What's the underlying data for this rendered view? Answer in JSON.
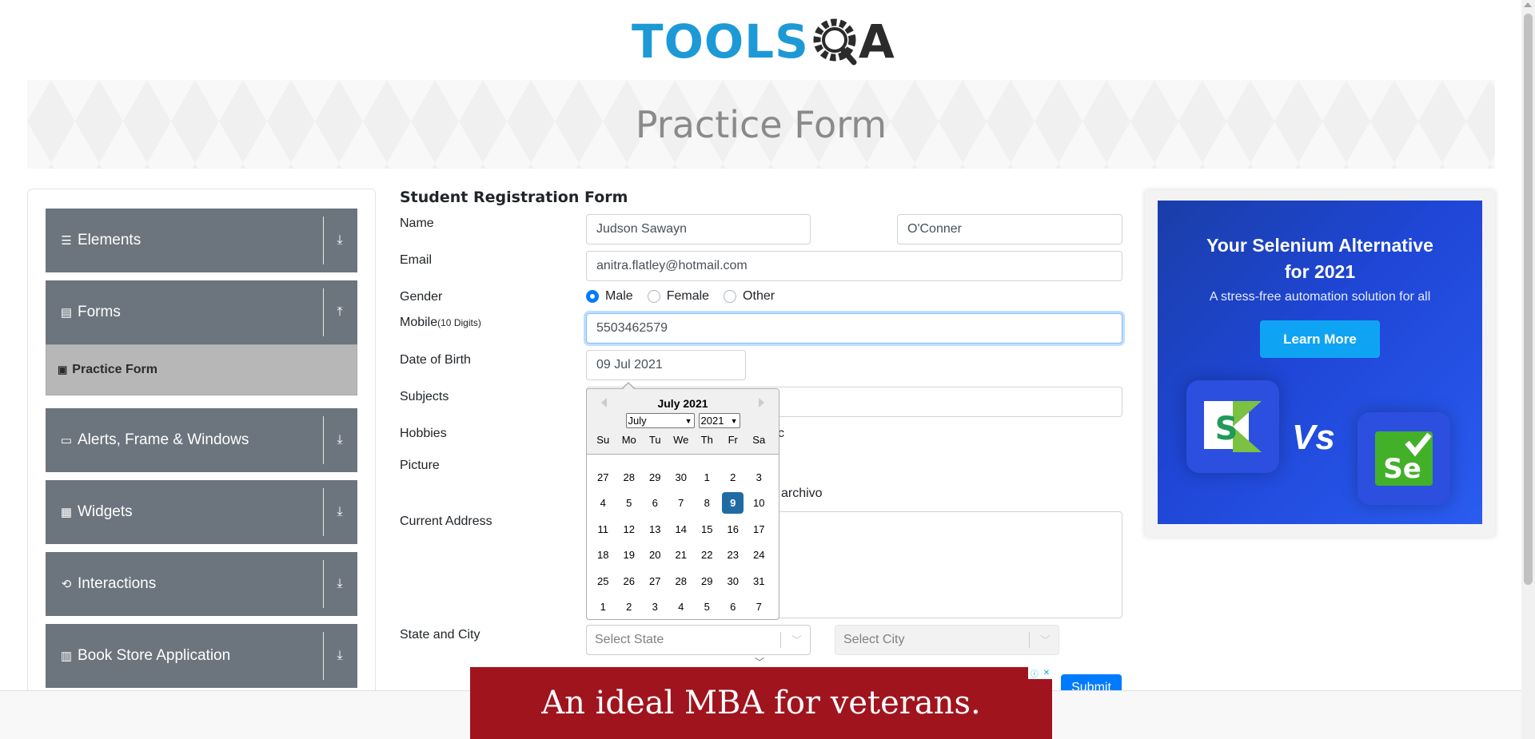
{
  "header": {
    "logo_main": "TOOLS",
    "logo_end": "A"
  },
  "banner": {
    "title": "Practice Form"
  },
  "sidebar": {
    "groups": [
      {
        "label": "Elements",
        "icon": "menu-icon"
      },
      {
        "label": "Forms",
        "icon": "document-icon",
        "expanded": true,
        "sub_items": [
          {
            "label": "Practice Form",
            "icon": "form-icon"
          }
        ]
      },
      {
        "label": "Alerts, Frame & Windows",
        "icon": "window-icon"
      },
      {
        "label": "Widgets",
        "icon": "grid-icon"
      },
      {
        "label": "Interactions",
        "icon": "cycle-icon"
      },
      {
        "label": "Book Store Application",
        "icon": "books-icon"
      }
    ]
  },
  "form": {
    "title": "Student Registration Form",
    "labels": {
      "name": "Name",
      "email": "Email",
      "gender": "Gender",
      "mobile": "Mobile",
      "mobile_hint": "(10 Digits)",
      "dob": "Date of Birth",
      "subjects": "Subjects",
      "hobbies": "Hobbies",
      "picture": "Picture",
      "address": "Current Address",
      "state_city": "State and City"
    },
    "first_name": "Judson Sawayn",
    "last_name": "O'Conner",
    "email": "anitra.flatley@hotmail.com",
    "gender_options": [
      "Male",
      "Female",
      "Other"
    ],
    "gender_selected": "Male",
    "mobile": "5503462579",
    "dob": "09 Jul 2021",
    "hobbies_partial": "c",
    "picture_partial": "archivo",
    "state_placeholder": "Select State",
    "city_placeholder": "Select City",
    "submit_label": "Submit"
  },
  "datepicker": {
    "month_title": "July 2021",
    "month_select": "July",
    "year_select": "2021",
    "weekdays": [
      "Su",
      "Mo",
      "Tu",
      "We",
      "Th",
      "Fr",
      "Sa"
    ],
    "weeks": [
      [
        "27",
        "28",
        "29",
        "30",
        "1",
        "2",
        "3"
      ],
      [
        "4",
        "5",
        "6",
        "7",
        "8",
        "9",
        "10"
      ],
      [
        "11",
        "12",
        "13",
        "14",
        "15",
        "16",
        "17"
      ],
      [
        "18",
        "19",
        "20",
        "21",
        "22",
        "23",
        "24"
      ],
      [
        "25",
        "26",
        "27",
        "28",
        "29",
        "30",
        "31"
      ],
      [
        "1",
        "2",
        "3",
        "4",
        "5",
        "6",
        "7"
      ]
    ],
    "selected_day": "9"
  },
  "right_ad": {
    "title_line1": "Your Selenium Alternative",
    "title_line2": "for 2021",
    "subtitle": "A stress-free automation solution for all",
    "button": "Learn More",
    "vs": "Vs",
    "logo1_letter": "S",
    "logo2_letters": "Se"
  },
  "bottom_ad": {
    "text": "An ideal MBA for veterans."
  },
  "colors": {
    "sidebar": "#6c757d",
    "accent": "#007bff",
    "selected_day": "#216ba5",
    "logo_blue": "#1d9ad6"
  }
}
